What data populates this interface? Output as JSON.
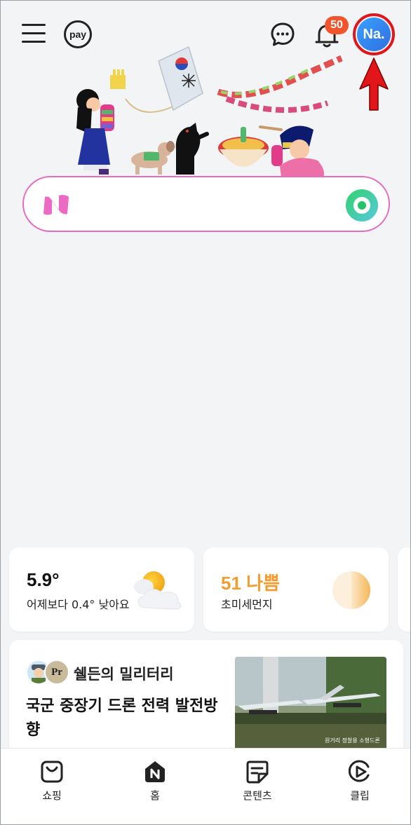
{
  "header": {
    "pay_label": "pay",
    "notification_count": "50",
    "avatar_initials": "Na.",
    "colors": {
      "badge": "#f2552c",
      "avatar": "#2f6fe0",
      "highlight": "#e0161a"
    }
  },
  "search": {
    "logo_letter": "N",
    "border_color": "#e56bc0"
  },
  "weather": {
    "temperature": "5.9°",
    "comparison": "어제보다 0.4° 낮아요",
    "icon": "partly-cloudy-icon"
  },
  "dust": {
    "value": "51 나쁨",
    "label": "초미세먼지",
    "color": "#f39c2f"
  },
  "news": {
    "source": "쉘든의 밀리터리",
    "avatar_text": "Pr",
    "title": "국군 중장기 드론 전력 발전방향",
    "thumb_caption": "원거리 정찰용 소형드론"
  },
  "bottom_nav": {
    "items": [
      {
        "label": "쇼핑",
        "icon": "shopping-bag-icon"
      },
      {
        "label": "홈",
        "icon": "home-n-icon"
      },
      {
        "label": "콘텐츠",
        "icon": "contents-icon"
      },
      {
        "label": "클립",
        "icon": "clip-play-icon"
      }
    ]
  }
}
